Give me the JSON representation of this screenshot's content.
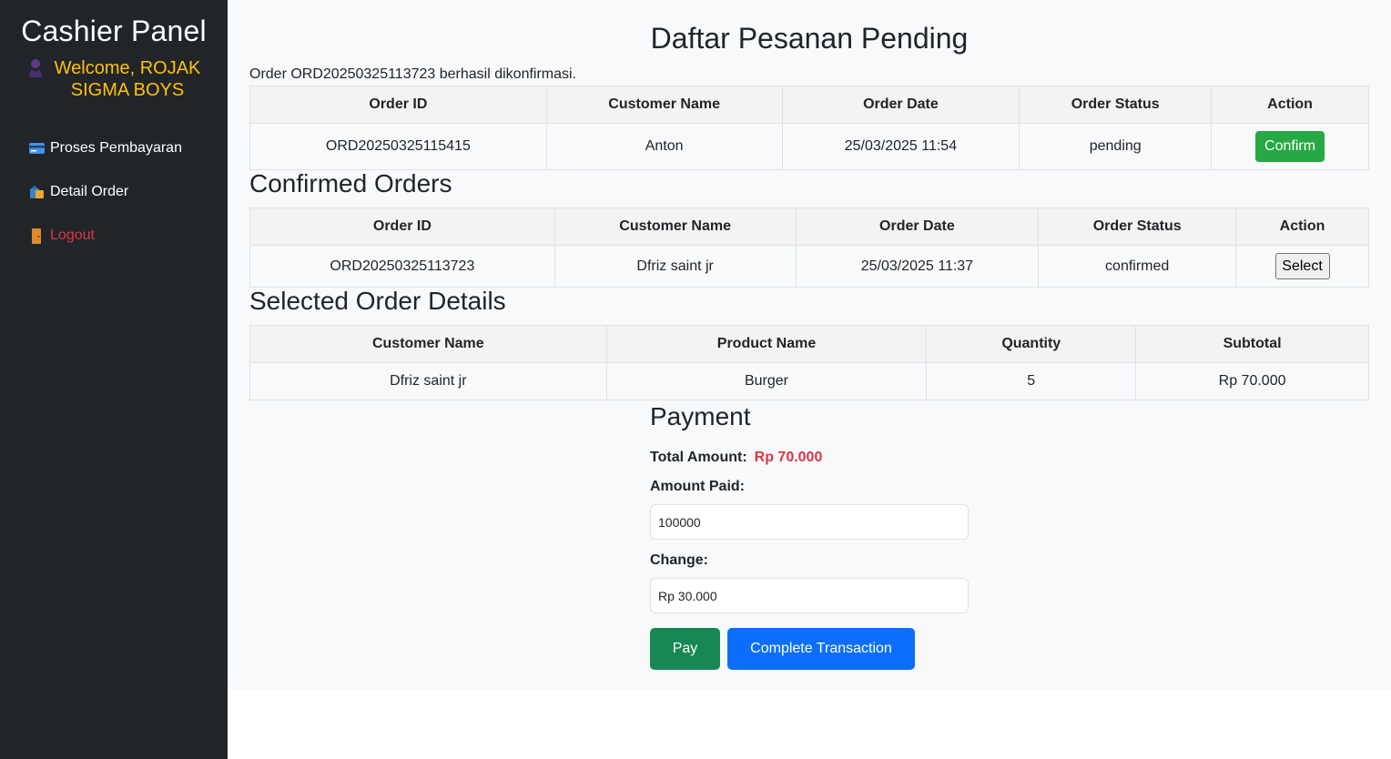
{
  "sidebar": {
    "brand": "Cashier Panel",
    "welcome_line1": "Welcome, ROJAK",
    "welcome_line2": "SIGMA BOYS",
    "items": [
      {
        "label": "Proses Pembayaran",
        "icon": "credit-card-icon"
      },
      {
        "label": "Detail Order",
        "icon": "shopping-bags-icon"
      },
      {
        "label": "Logout",
        "icon": "door-icon"
      }
    ]
  },
  "main": {
    "title": "Daftar Pesanan Pending",
    "message": "Order ORD20250325113723 berhasil dikonfirmasi."
  },
  "pending_table": {
    "headers": [
      "Order ID",
      "Customer Name",
      "Order Date",
      "Order Status",
      "Action"
    ],
    "rows": [
      {
        "order_id": "ORD20250325115415",
        "customer": "Anton",
        "date": "25/03/2025 11:54",
        "status": "pending",
        "action": "Confirm"
      }
    ]
  },
  "confirmed": {
    "title": "Confirmed Orders",
    "headers": [
      "Order ID",
      "Customer Name",
      "Order Date",
      "Order Status",
      "Action"
    ],
    "rows": [
      {
        "order_id": "ORD20250325113723",
        "customer": "Dfriz saint jr",
        "date": "25/03/2025 11:37",
        "status": "confirmed",
        "action": "Select"
      }
    ]
  },
  "details": {
    "title": "Selected Order Details",
    "headers": [
      "Customer Name",
      "Product Name",
      "Quantity",
      "Subtotal"
    ],
    "rows": [
      {
        "customer": "Dfriz saint jr",
        "product": "Burger",
        "quantity": "5",
        "subtotal": "Rp 70.000"
      }
    ]
  },
  "payment": {
    "title": "Payment",
    "total_label": "Total Amount:",
    "total_value": "Rp 70.000",
    "paid_label": "Amount Paid:",
    "paid_value": "100000",
    "change_label": "Change:",
    "change_value": "Rp 30.000",
    "pay_button": "Pay",
    "complete_button": "Complete Transaction"
  },
  "colors": {
    "sidebar_bg": "#212529",
    "welcome": "#ffc107",
    "logout": "#dc3545",
    "confirm_btn": "#28a745",
    "pay_btn": "#198754",
    "complete_btn": "#0d6efd",
    "total_amount": "#dc3545"
  }
}
